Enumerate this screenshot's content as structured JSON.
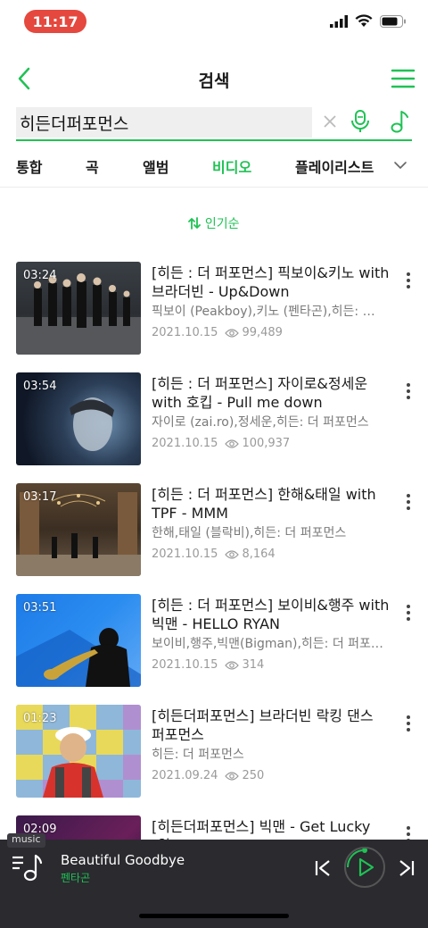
{
  "status_bar": {
    "time": "11:17"
  },
  "header": {
    "title": "검색"
  },
  "search": {
    "value": "히든더퍼포먼스"
  },
  "tabs": [
    {
      "label": "통합"
    },
    {
      "label": "곡"
    },
    {
      "label": "앨범"
    },
    {
      "label": "비디오",
      "active": true
    },
    {
      "label": "플레이리스트"
    }
  ],
  "sort": {
    "label": "인기순"
  },
  "videos": [
    {
      "duration": "03:24",
      "title": "[히든 : 더 퍼포먼스] 픽보이&키노 with 브라더빈 - Up&Down",
      "artist": "픽보이 (Peakboy),키노 (펜타곤),히든: 더 퍼포먼스",
      "date": "2021.10.15",
      "views": "99,489"
    },
    {
      "duration": "03:54",
      "title": "[히든 : 더 퍼포먼스] 자이로&정세운 with 호킵 - Pull me down",
      "artist": "자이로 (zai.ro),정세운,히든: 더 퍼포먼스",
      "date": "2021.10.15",
      "views": "100,937"
    },
    {
      "duration": "03:17",
      "title": "[히든 : 더 퍼포먼스] 한해&태일 with TPF - MMM",
      "artist": "한해,태일 (블락비),히든: 더 퍼포먼스",
      "date": "2021.10.15",
      "views": "8,164"
    },
    {
      "duration": "03:51",
      "title": "[히든 : 더 퍼포먼스] 보이비&행주 with 빅맨 - HELLO RYAN",
      "artist": "보이비,행주,빅맨(Bigman),히든: 더 퍼포먼스",
      "date": "2021.10.15",
      "views": "314"
    },
    {
      "duration": "01:23",
      "title": "[히든더퍼포먼스] 브라더빈 락킹 댄스 퍼포먼스",
      "artist": "히든: 더 퍼포먼스",
      "date": "2021.09.24",
      "views": "250"
    },
    {
      "duration": "02:09",
      "title": "[히든더퍼포먼스] 빅맨 - Get Lucky (원",
      "artist": "",
      "date": "",
      "views": ""
    }
  ],
  "player": {
    "tag": "music",
    "track_title": "Beautiful Goodbye",
    "track_artist": "펜타곤"
  },
  "colors": {
    "accent": "#1fc254",
    "status_pill": "#e5483e",
    "player_bg": "#2a2a2f"
  }
}
